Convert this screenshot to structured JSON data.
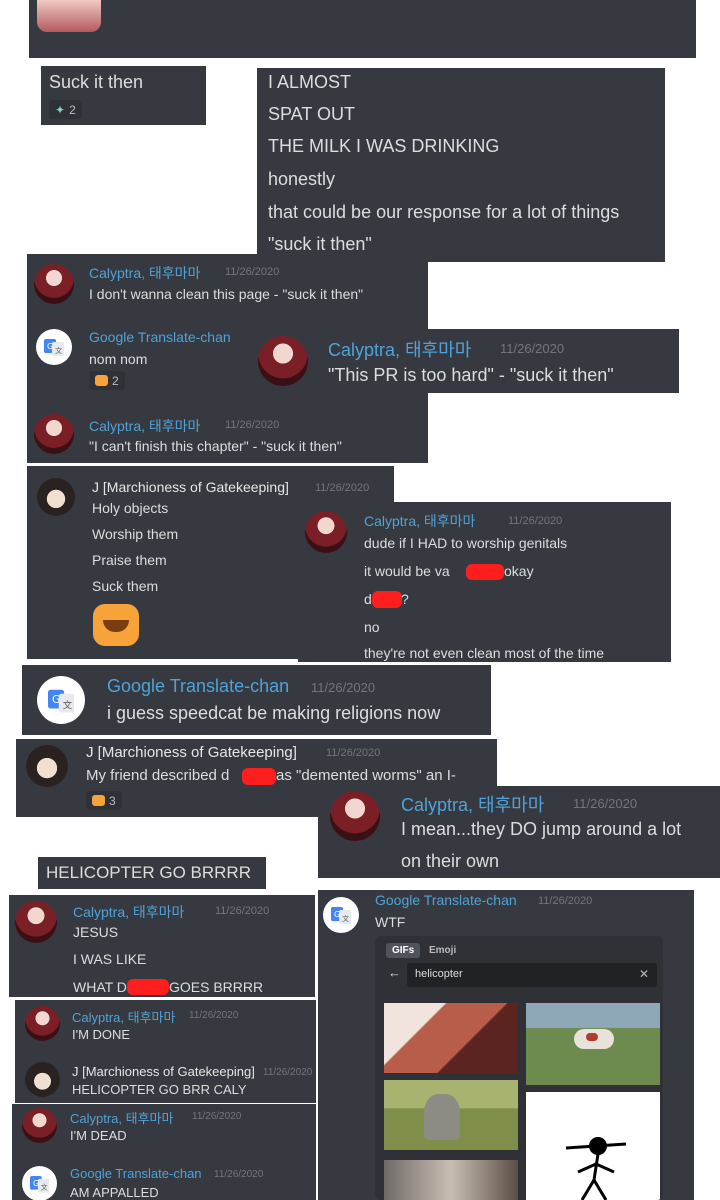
{
  "top_reaction": {
    "label": "Suck it then",
    "count": "2"
  },
  "almost": {
    "lines": [
      "I ALMOST",
      "SPAT OUT",
      "THE MILK I WAS DRINKING",
      "honestly",
      "that could be our response for a lot of things",
      "\"suck it then\""
    ]
  },
  "users": {
    "caly": "Calyptra, 태후마마",
    "gt": "Google Translate-chan",
    "j": "J [Marchioness of Gatekeeping]"
  },
  "timestamp": "11/26/2020",
  "chat1": {
    "m1_text": "I don't wanna clean this page - \"suck it then\"",
    "m2_text": "nom nom",
    "m2_reaction": "2",
    "m3_text": "\"I can't finish this chapter\" - \"suck it then\""
  },
  "pr_msg": {
    "text": "\"This PR is too hard\" - \"suck it then\""
  },
  "j_msg": {
    "lines": [
      "Holy objects",
      "Worship them",
      "Praise them",
      "Suck them"
    ]
  },
  "caly_msg": {
    "l1": "dude if I HAD to worship genitals",
    "l2a": "it would be va",
    "l2b": "okay",
    "l3": "d",
    "l3b": "?",
    "l4": "no",
    "l5": "they're not even clean most of the time"
  },
  "gt_big": {
    "text": "i guess speedcat be making religions now"
  },
  "j_worms": {
    "text_a": "My friend described d",
    "text_b": "as \"demented worms\" an I-",
    "reaction": "3"
  },
  "caly_jump": {
    "l1": "I mean...they DO jump around a lot",
    "l2": "on their own"
  },
  "heli_label": "HELICOPTER GO BRRRR",
  "jesus": {
    "l1": "JESUS",
    "l2": "I WAS LIKE",
    "l3a": "WHAT D",
    "l3b": "GOES BRRRR"
  },
  "done": {
    "m1": "I'M DONE",
    "m2": "HELICOPTER GO BRR CALY"
  },
  "dead": {
    "m1": "I'M DEAD",
    "m2": "AM APPALLED"
  },
  "wtf": {
    "text": "WTF",
    "tab_gifs": "GIFs",
    "tab_emoji": "Emoji",
    "search_value": "helicopter",
    "back_icon": "←",
    "clear_icon": "✕"
  }
}
